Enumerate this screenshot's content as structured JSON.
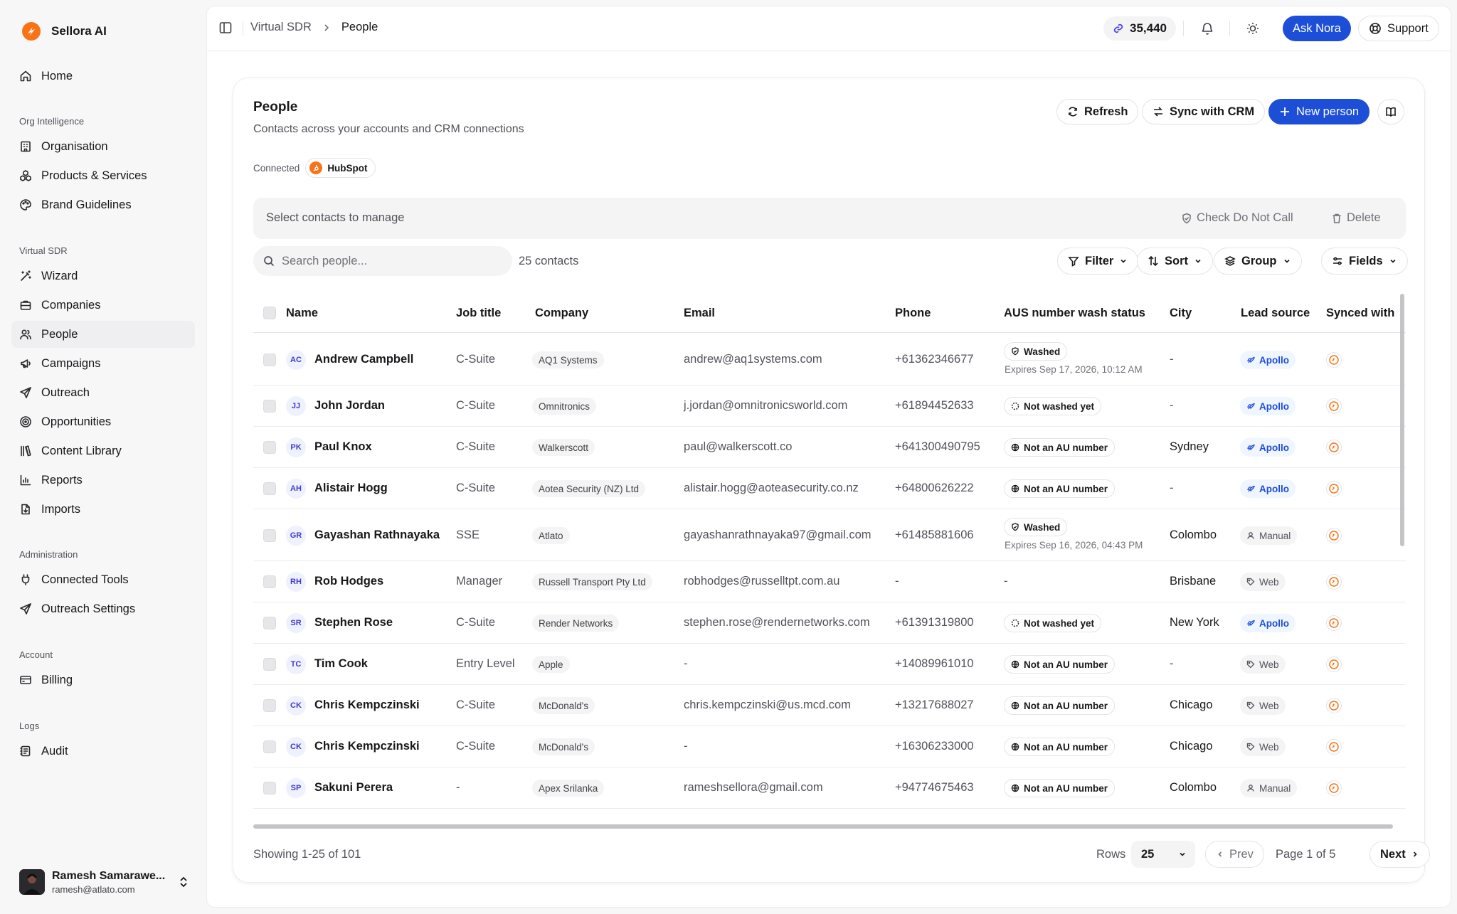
{
  "app": {
    "name": "Sellora AI"
  },
  "sidebar": {
    "top": [
      {
        "label": "Home",
        "icon": "home-icon"
      }
    ],
    "sections": [
      {
        "title": "Org Intelligence",
        "items": [
          {
            "label": "Organisation",
            "icon": "building-icon"
          },
          {
            "label": "Products & Services",
            "icon": "boxes-icon"
          },
          {
            "label": "Brand Guidelines",
            "icon": "palette-icon"
          }
        ]
      },
      {
        "title": "Virtual SDR",
        "items": [
          {
            "label": "Wizard",
            "icon": "wand-icon"
          },
          {
            "label": "Companies",
            "icon": "briefcase-icon"
          },
          {
            "label": "People",
            "icon": "users-icon",
            "active": true
          },
          {
            "label": "Campaigns",
            "icon": "megaphone-icon"
          },
          {
            "label": "Outreach",
            "icon": "send-icon"
          },
          {
            "label": "Opportunities",
            "icon": "target-icon"
          },
          {
            "label": "Content Library",
            "icon": "library-icon"
          },
          {
            "label": "Reports",
            "icon": "chart-icon"
          },
          {
            "label": "Imports",
            "icon": "file-import-icon"
          }
        ]
      },
      {
        "title": "Administration",
        "items": [
          {
            "label": "Connected Tools",
            "icon": "plug-icon"
          },
          {
            "label": "Outreach Settings",
            "icon": "send-icon"
          }
        ]
      },
      {
        "title": "Account",
        "items": [
          {
            "label": "Billing",
            "icon": "credit-card-icon"
          }
        ]
      },
      {
        "title": "Logs",
        "items": [
          {
            "label": "Audit",
            "icon": "audit-icon"
          }
        ]
      }
    ],
    "user": {
      "name": "Ramesh Samarawe...",
      "email": "ramesh@atlato.com"
    }
  },
  "topbar": {
    "breadcrumb": [
      "Virtual SDR",
      "People"
    ],
    "credits": "35,440",
    "ask_label": "Ask Nora",
    "support_label": "Support"
  },
  "page": {
    "title": "People",
    "subtitle": "Contacts across your accounts and CRM connections",
    "actions": {
      "refresh": "Refresh",
      "sync": "Sync with CRM",
      "new": "New person"
    },
    "connected_label": "Connected",
    "crm": "HubSpot",
    "bulk": {
      "text": "Select contacts to manage",
      "dnc": "Check Do Not Call",
      "delete": "Delete"
    },
    "search_placeholder": "Search people...",
    "count": "25 contacts",
    "tools": {
      "filter": "Filter",
      "sort": "Sort",
      "group": "Group",
      "fields": "Fields"
    }
  },
  "table": {
    "columns": [
      "Name",
      "Job title",
      "Company",
      "Email",
      "Phone",
      "AUS number wash status",
      "City",
      "Lead source",
      "Synced with"
    ],
    "rows": [
      {
        "initials": "AC",
        "name": "Andrew Campbell",
        "job": "C-Suite",
        "company": "AQ1 Systems",
        "email": "andrew@aq1systems.com",
        "phone": "+61362346677",
        "wash": "Washed",
        "wash_type": "washed",
        "wash_sub": "Expires Sep 17, 2026, 10:12 AM",
        "city": "-",
        "source": "Apollo",
        "source_type": "apollo"
      },
      {
        "initials": "JJ",
        "name": "John Jordan",
        "job": "C-Suite",
        "company": "Omnitronics",
        "email": "j.jordan@omnitronicsworld.com",
        "phone": "+61894452633",
        "wash": "Not washed yet",
        "wash_type": "pending",
        "wash_sub": "",
        "city": "-",
        "source": "Apollo",
        "source_type": "apollo"
      },
      {
        "initials": "PK",
        "name": "Paul Knox",
        "job": "C-Suite",
        "company": "Walkerscott",
        "email": "paul@walkerscott.co",
        "phone": "+641300490795",
        "wash": "Not an AU number",
        "wash_type": "globe",
        "wash_sub": "",
        "city": "Sydney",
        "source": "Apollo",
        "source_type": "apollo"
      },
      {
        "initials": "AH",
        "name": "Alistair Hogg",
        "job": "C-Suite",
        "company": "Aotea Security (NZ) Ltd",
        "email": "alistair.hogg@aoteasecurity.co.nz",
        "phone": "+64800626222",
        "wash": "Not an AU number",
        "wash_type": "globe",
        "wash_sub": "",
        "city": "-",
        "source": "Apollo",
        "source_type": "apollo"
      },
      {
        "initials": "GR",
        "name": "Gayashan Rathnayaka",
        "job": "SSE",
        "company": "Atlato",
        "email": "gayashanrathnayaka97@gmail.com",
        "phone": "+61485881606",
        "wash": "Washed",
        "wash_type": "washed",
        "wash_sub": "Expires Sep 16, 2026, 04:43 PM",
        "city": "Colombo",
        "source": "Manual",
        "source_type": "manual"
      },
      {
        "initials": "RH",
        "name": "Rob Hodges",
        "job": "Manager",
        "company": "Russell Transport Pty Ltd",
        "email": "robhodges@russelltpt.com.au",
        "phone": "-",
        "wash": "-",
        "wash_type": "none",
        "wash_sub": "",
        "city": "Brisbane",
        "source": "Web",
        "source_type": "web"
      },
      {
        "initials": "SR",
        "name": "Stephen Rose",
        "job": "C-Suite",
        "company": "Render Networks",
        "email": "stephen.rose@rendernetworks.com",
        "phone": "+61391319800",
        "wash": "Not washed yet",
        "wash_type": "pending",
        "wash_sub": "",
        "city": "New York",
        "source": "Apollo",
        "source_type": "apollo"
      },
      {
        "initials": "TC",
        "name": "Tim Cook",
        "job": "Entry Level",
        "company": "Apple",
        "email": "-",
        "phone": "+14089961010",
        "wash": "Not an AU number",
        "wash_type": "globe",
        "wash_sub": "",
        "city": "-",
        "source": "Web",
        "source_type": "web"
      },
      {
        "initials": "CK",
        "name": "Chris Kempczinski",
        "job": "C-Suite",
        "company": "McDonald's",
        "email": "chris.kempczinski@us.mcd.com",
        "phone": "+13217688027",
        "wash": "Not an AU number",
        "wash_type": "globe",
        "wash_sub": "",
        "city": "Chicago",
        "source": "Web",
        "source_type": "web"
      },
      {
        "initials": "CK",
        "name": "Chris Kempczinski",
        "job": "C-Suite",
        "company": "McDonald's",
        "email": "-",
        "phone": "+16306233000",
        "wash": "Not an AU number",
        "wash_type": "globe",
        "wash_sub": "",
        "city": "Chicago",
        "source": "Web",
        "source_type": "web"
      },
      {
        "initials": "SP",
        "name": "Sakuni Perera",
        "job": "-",
        "company": "Apex Srilanka",
        "email": "rameshsellora@gmail.com",
        "phone": "+94774675463",
        "wash": "Not an AU number",
        "wash_type": "globe",
        "wash_sub": "",
        "city": "Colombo",
        "source": "Manual",
        "source_type": "manual"
      }
    ]
  },
  "footer": {
    "showing": "Showing 1-25 of 101",
    "rows_label": "Rows",
    "rows_value": "25",
    "prev": "Prev",
    "page_info": "Page 1 of 5",
    "next": "Next"
  },
  "colors": {
    "accent": "#1d4ed8",
    "hubspot": "#f97316",
    "apollo": "#1d4ed8"
  }
}
